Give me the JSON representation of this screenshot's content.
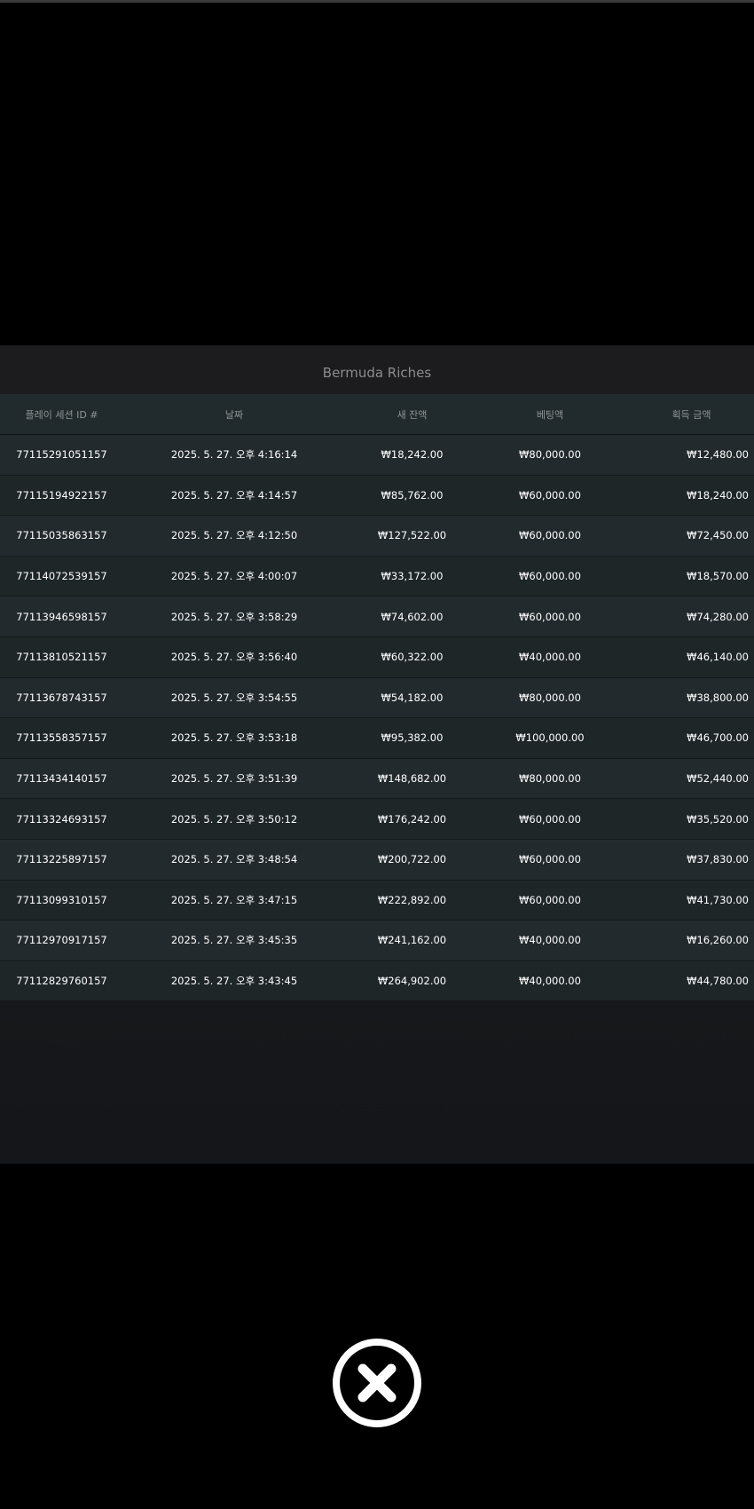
{
  "game_title": "Bermuda Riches",
  "table": {
    "headers": {
      "session_id": "플레이 세션 ID #",
      "date": "날짜",
      "new_balance": "새 잔액",
      "bet": "베팅액",
      "win": "획득 금액"
    },
    "rows": [
      {
        "id": "77115291051157",
        "date": "2025. 5. 27. 오후 4:16:14",
        "balance": "₩18,242.00",
        "bet": "₩80,000.00",
        "win": "₩12,480.00"
      },
      {
        "id": "77115194922157",
        "date": "2025. 5. 27. 오후 4:14:57",
        "balance": "₩85,762.00",
        "bet": "₩60,000.00",
        "win": "₩18,240.00"
      },
      {
        "id": "77115035863157",
        "date": "2025. 5. 27. 오후 4:12:50",
        "balance": "₩127,522.00",
        "bet": "₩60,000.00",
        "win": "₩72,450.00"
      },
      {
        "id": "77114072539157",
        "date": "2025. 5. 27. 오후 4:00:07",
        "balance": "₩33,172.00",
        "bet": "₩60,000.00",
        "win": "₩18,570.00"
      },
      {
        "id": "77113946598157",
        "date": "2025. 5. 27. 오후 3:58:29",
        "balance": "₩74,602.00",
        "bet": "₩60,000.00",
        "win": "₩74,280.00"
      },
      {
        "id": "77113810521157",
        "date": "2025. 5. 27. 오후 3:56:40",
        "balance": "₩60,322.00",
        "bet": "₩40,000.00",
        "win": "₩46,140.00"
      },
      {
        "id": "77113678743157",
        "date": "2025. 5. 27. 오후 3:54:55",
        "balance": "₩54,182.00",
        "bet": "₩80,000.00",
        "win": "₩38,800.00"
      },
      {
        "id": "77113558357157",
        "date": "2025. 5. 27. 오후 3:53:18",
        "balance": "₩95,382.00",
        "bet": "₩100,000.00",
        "win": "₩46,700.00"
      },
      {
        "id": "77113434140157",
        "date": "2025. 5. 27. 오후 3:51:39",
        "balance": "₩148,682.00",
        "bet": "₩80,000.00",
        "win": "₩52,440.00"
      },
      {
        "id": "77113324693157",
        "date": "2025. 5. 27. 오후 3:50:12",
        "balance": "₩176,242.00",
        "bet": "₩60,000.00",
        "win": "₩35,520.00"
      },
      {
        "id": "77113225897157",
        "date": "2025. 5. 27. 오후 3:48:54",
        "balance": "₩200,722.00",
        "bet": "₩60,000.00",
        "win": "₩37,830.00"
      },
      {
        "id": "77113099310157",
        "date": "2025. 5. 27. 오후 3:47:15",
        "balance": "₩222,892.00",
        "bet": "₩60,000.00",
        "win": "₩41,730.00"
      },
      {
        "id": "77112970917157",
        "date": "2025. 5. 27. 오후 3:45:35",
        "balance": "₩241,162.00",
        "bet": "₩40,000.00",
        "win": "₩16,260.00"
      },
      {
        "id": "77112829760157",
        "date": "2025. 5. 27. 오후 3:43:45",
        "balance": "₩264,902.00",
        "bet": "₩40,000.00",
        "win": "₩44,780.00"
      }
    ]
  },
  "close_button": {
    "icon": "close-icon"
  },
  "colors": {
    "background": "#000000",
    "panel": "#1b1c1e",
    "header_row": "#212a2c",
    "row": "#232a2d",
    "muted_text": "#868b8d",
    "text": "#ffffff"
  }
}
